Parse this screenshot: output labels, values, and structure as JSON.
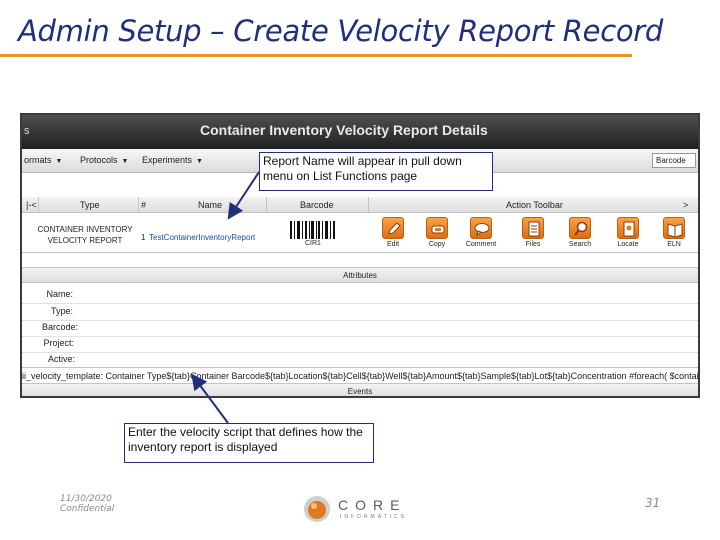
{
  "slide": {
    "title": "Admin Setup – Create Velocity Report Record",
    "footer_date": "11/30/2020",
    "footer_conf": "Confidential",
    "page_number": "31",
    "logo_word": "CORE",
    "logo_sub": "INFORMATICS",
    "accent_color": "#e8961e",
    "title_color": "#1f2f7a"
  },
  "app": {
    "left_glyph": "s",
    "header_title": "Container Inventory Velocity Report Details",
    "menu": [
      {
        "label": "ormats"
      },
      {
        "label": "Protocols"
      },
      {
        "label": "Experiments"
      }
    ],
    "barcode_field": "Barcode",
    "columns": {
      "first": "|-<",
      "type": "Type",
      "num": "#",
      "name": "Name",
      "barcode": "Barcode",
      "action_toolbar": "Action Toolbar",
      "end": ">"
    },
    "row": {
      "type": "CONTAINER INVENTORY VELOCITY REPORT",
      "num": "1",
      "name": "TestContainerInventoryReport",
      "barcode": "CIR1"
    },
    "tools": [
      {
        "label": "Edit",
        "icon": "pencil-icon"
      },
      {
        "label": "Copy",
        "icon": "copy-icon"
      },
      {
        "label": "Comment",
        "icon": "comment-icon"
      },
      {
        "label": "Files",
        "icon": "files-icon"
      },
      {
        "label": "Search",
        "icon": "search-icon"
      },
      {
        "label": "Locate",
        "icon": "locate-icon"
      },
      {
        "label": "ELN",
        "icon": "eln-book-icon"
      }
    ],
    "attributes_label": "Attributes",
    "attributes": [
      "Name:",
      "Type:",
      "Barcode:",
      "Project:",
      "Active:"
    ],
    "template_text": "ii_velocity_template: Container Type${tab}Container Barcode${tab}Location${tab}Cell${tab}Well${tab}Amount${tab}Sample${tab}Lot${tab}Concentration #foreach( $container in $co",
    "events_label": "Events"
  },
  "callouts": {
    "top": "Report Name will appear in pull down menu on List Functions page",
    "bottom": "Enter the velocity script that defines how the inventory report is displayed"
  }
}
